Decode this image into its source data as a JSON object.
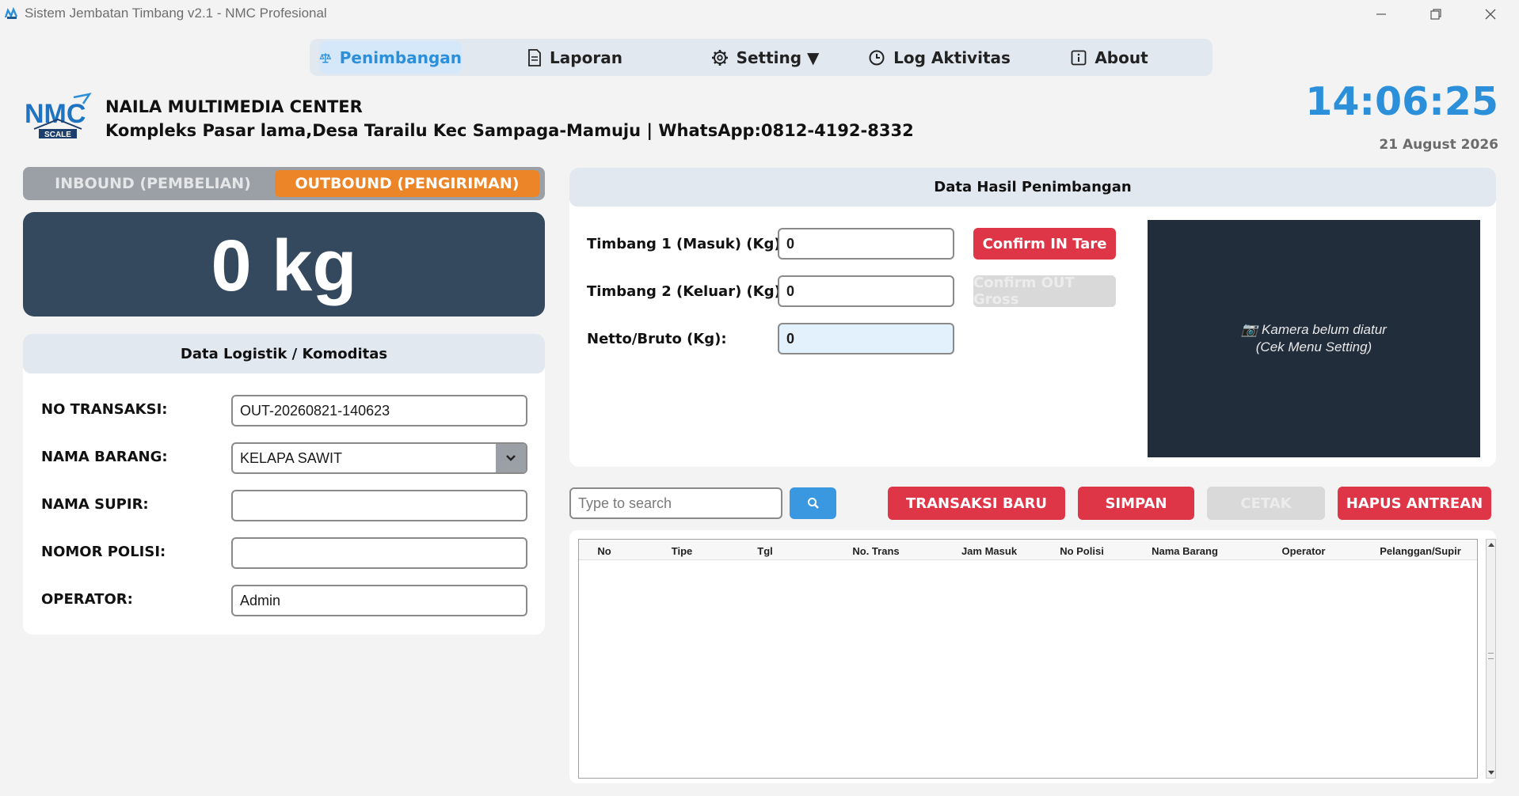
{
  "window": {
    "title": "Sistem Jembatan Timbang v2.1 - NMC Profesional"
  },
  "nav": {
    "items": [
      {
        "label": "Penimbangan",
        "icon": "scale-icon",
        "active": true
      },
      {
        "label": "Laporan",
        "icon": "document-icon",
        "active": false
      },
      {
        "label": "Setting ▼",
        "icon": "gear-icon",
        "active": false
      },
      {
        "label": "Log Aktivitas",
        "icon": "clock-icon",
        "active": false
      },
      {
        "label": "About",
        "icon": "info-icon",
        "active": false
      }
    ]
  },
  "header": {
    "logo_text": "NMC",
    "logo_sub": "SCALE",
    "company": "NAILA MULTIMEDIA CENTER",
    "address": "Kompleks Pasar lama,Desa Tarailu Kec Sampaga-Mamuju | WhatsApp:0812-4192-8332",
    "time": "14:06:25",
    "date": "21 August 2026"
  },
  "mode": {
    "inbound": "INBOUND (PEMBELIAN)",
    "outbound": "OUTBOUND (PENGIRIMAN)",
    "active": "outbound"
  },
  "weight": {
    "display": "0 kg"
  },
  "logistik": {
    "title": "Data Logistik / Komoditas",
    "fields": {
      "no_transaksi": {
        "label": "NO TRANSAKSI:",
        "value": "OUT-20260821-140623"
      },
      "nama_barang": {
        "label": "NAMA BARANG:",
        "value": "KELAPA SAWIT"
      },
      "nama_supir": {
        "label": "NAMA SUPIR:",
        "value": ""
      },
      "nomor_polisi": {
        "label": "NOMOR POLISI:",
        "value": ""
      },
      "operator": {
        "label": "OPERATOR:",
        "value": "Admin"
      }
    }
  },
  "hasil": {
    "title": "Data Hasil Penimbangan",
    "timbang1": {
      "label": "Timbang 1 (Masuk) (Kg):",
      "value": "0"
    },
    "timbang2": {
      "label": "Timbang 2 (Keluar) (Kg):",
      "value": "0"
    },
    "netto": {
      "label": "Netto/Bruto (Kg):",
      "value": "0"
    },
    "confirm_in": "Confirm IN Tare",
    "confirm_out": "Confirm OUT Gross",
    "camera_line1": "📷 Kamera belum diatur",
    "camera_line2": "(Cek Menu Setting)"
  },
  "actions": {
    "search_placeholder": "Type to search",
    "transaksi_baru": "TRANSAKSI BARU",
    "simpan": "SIMPAN",
    "cetak": "CETAK",
    "hapus_antrean": "HAPUS ANTREAN"
  },
  "table": {
    "columns": [
      "No",
      "Tipe",
      "Tgl",
      "No. Trans",
      "Jam Masuk",
      "No Polisi",
      "Nama Barang",
      "Operator",
      "Pelanggan/Supir"
    ],
    "rows": []
  },
  "colors": {
    "accent_blue": "#2b8fd9",
    "outbound_orange": "#ec8428",
    "danger_red": "#de3547",
    "weight_panel": "#34495e",
    "camera_bg": "#222d3b"
  }
}
